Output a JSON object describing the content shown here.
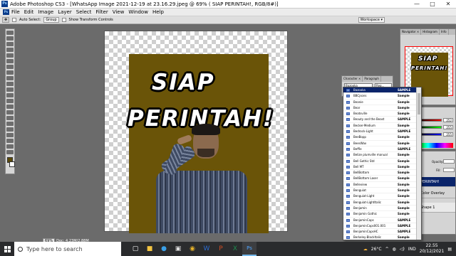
{
  "window": {
    "title": "Adobe Photoshop CS3 - [WhatsApp Image 2021-12-19 at 23.16.29.jpeg @ 69% ( SIAP  PERINTAH!, RGB/8#)]",
    "app_icon": "Ps",
    "controls": [
      "—",
      "□",
      "✕"
    ]
  },
  "menu": [
    "File",
    "Edit",
    "Image",
    "Layer",
    "Select",
    "Filter",
    "View",
    "Window",
    "Help"
  ],
  "options_bar": {
    "auto_select": "Auto Select:",
    "group": "Group",
    "show_transform": "Show Transform Controls",
    "workspace": "Workspace ▾"
  },
  "document": {
    "caption_line1": "SIAP",
    "caption_line2": "PERINTAH!",
    "zoom": "69%",
    "doc_size": "Doc: 4,23M/2,88M"
  },
  "navigator": {
    "tabs": [
      "Navigator ×",
      "Histogram",
      "Info"
    ],
    "caption_line1": "SIAP",
    "caption_line2": "PERINTAH!"
  },
  "color_panel": {
    "values": [
      "252",
      "255",
      "255"
    ]
  },
  "character_panel": {
    "tabs": [
      "Character ×",
      "Paragraph"
    ],
    "font": "Bazooka",
    "style": "Reg..."
  },
  "font_list": [
    {
      "name": "Bazooka",
      "sample": "SAMPLE"
    },
    {
      "name": "BBCjsons",
      "sample": "Sample"
    },
    {
      "name": "Beanie",
      "sample": "Sample"
    },
    {
      "name": "Bear",
      "sample": "Sample"
    },
    {
      "name": "Beatsville",
      "sample": "Sample"
    },
    {
      "name": "Beauty and the Beast",
      "sample": "SAMPLE"
    },
    {
      "name": "Becker-Medium",
      "sample": "Sample"
    },
    {
      "name": "Bedrock-Light",
      "sample": "SAMPLE"
    },
    {
      "name": "BeeBopp",
      "sample": "Sample"
    },
    {
      "name": "BeesWax",
      "sample": "Sample"
    },
    {
      "name": "Beffle",
      "sample": "SAMPLE"
    },
    {
      "name": "Belize plumville manual",
      "sample": "Sample"
    },
    {
      "name": "Bell Gothic Std",
      "sample": "Sample"
    },
    {
      "name": "Bell MT",
      "sample": "Sample"
    },
    {
      "name": "BellBottom",
      "sample": "Sample"
    },
    {
      "name": "BellBottom Laser",
      "sample": "Sample"
    },
    {
      "name": "Belleview",
      "sample": "Sample"
    },
    {
      "name": "Benguiat",
      "sample": "Sample"
    },
    {
      "name": "Benguiat-Light",
      "sample": "Sample"
    },
    {
      "name": "Benguiat-LightItalic",
      "sample": "Sample"
    },
    {
      "name": "Benjamin",
      "sample": "Sample"
    },
    {
      "name": "Benjamin Gothic",
      "sample": "Sample"
    },
    {
      "name": "BenjaminCaps",
      "sample": "SAMPLE"
    },
    {
      "name": "BenjaminCaps001.001",
      "sample": "SAMPLE"
    },
    {
      "name": "BenjaminCapsHC",
      "sample": "SAMPLE"
    },
    {
      "name": "Berkeley-BlackItalic",
      "sample": "Sample"
    }
  ],
  "layers": {
    "opacity_label": "Opacity:",
    "fill_label": "Fill:",
    "layer_text": "PERINTAH!",
    "layer2": "Color Overlay",
    "layer3": "Shape 1"
  },
  "taskbar": {
    "search_placeholder": "Type here to search",
    "temperature": "26°C",
    "lang": "IND",
    "time": "22.55",
    "date": "20/12/2021"
  }
}
